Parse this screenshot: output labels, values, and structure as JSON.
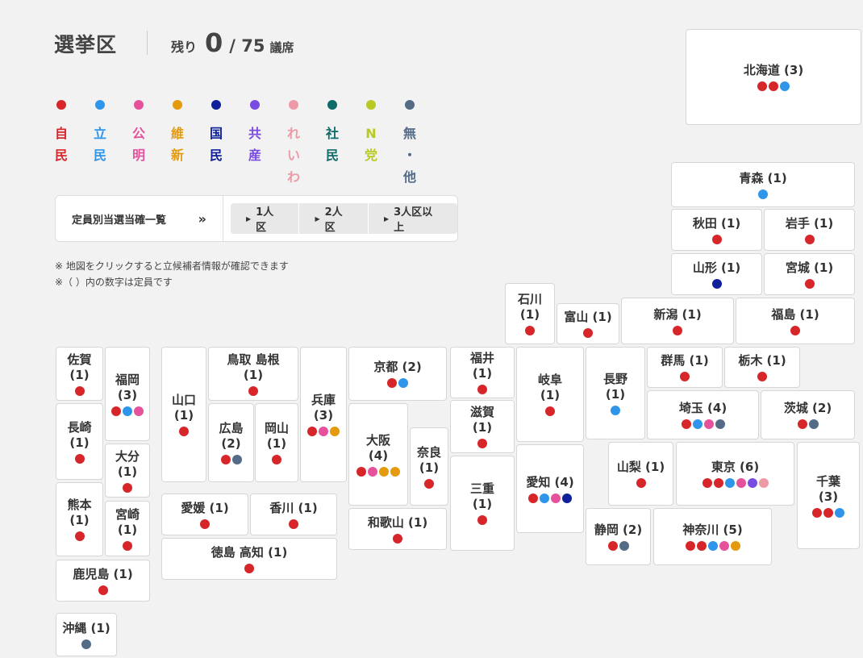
{
  "header": {
    "title": "選挙区",
    "remaining_label": "残り",
    "remaining_value": "0",
    "total": "/ 75",
    "unit": "議席"
  },
  "party_colors": {
    "ldp": "#d7262a",
    "cdp": "#2f95ea",
    "komei": "#e5529b",
    "ishin": "#e39a0f",
    "dpfp": "#10209a",
    "jcp": "#7a4be0",
    "reiwa": "#ee9aa6",
    "sdp": "#0f6a6a",
    "nhk": "#b8c923",
    "ind": "#546b86"
  },
  "legend": [
    {
      "key": "ldp",
      "chars": [
        "自",
        "民"
      ]
    },
    {
      "key": "cdp",
      "chars": [
        "立",
        "民"
      ]
    },
    {
      "key": "komei",
      "chars": [
        "公",
        "明"
      ]
    },
    {
      "key": "ishin",
      "chars": [
        "維",
        "新"
      ]
    },
    {
      "key": "dpfp",
      "chars": [
        "国",
        "民"
      ]
    },
    {
      "key": "jcp",
      "chars": [
        "共",
        "産"
      ]
    },
    {
      "key": "reiwa",
      "chars": [
        "れ",
        "い",
        "わ"
      ]
    },
    {
      "key": "sdp",
      "chars": [
        "社",
        "民"
      ]
    },
    {
      "key": "nhk",
      "chars": [
        "N",
        "党"
      ]
    },
    {
      "key": "ind",
      "chars": [
        "無",
        "・",
        "他"
      ]
    }
  ],
  "filter_panel": {
    "link_label": "定員別当選当確一覧",
    "link_icon": "double-chevron-right",
    "buttons": [
      "1人区",
      "2人区",
      "3人区以上"
    ]
  },
  "notes": [
    "※ 地図をクリックすると立候補者情報が確認できます",
    "※（ ）内の数字は定員です"
  ],
  "prefectures": [
    {
      "id": "hokkaido",
      "name": "北海道 (3)",
      "seats": [
        "ldp",
        "ldp",
        "cdp"
      ]
    },
    {
      "id": "aomori",
      "name": "青森 (1)",
      "seats": [
        "cdp"
      ]
    },
    {
      "id": "akita",
      "name": "秋田 (1)",
      "seats": [
        "ldp"
      ]
    },
    {
      "id": "iwate",
      "name": "岩手 (1)",
      "seats": [
        "ldp"
      ]
    },
    {
      "id": "yamagata",
      "name": "山形 (1)",
      "seats": [
        "dpfp"
      ]
    },
    {
      "id": "miyagi",
      "name": "宮城 (1)",
      "seats": [
        "ldp"
      ]
    },
    {
      "id": "ishikawa",
      "name": "石川\n(1)",
      "seats": [
        "ldp"
      ]
    },
    {
      "id": "toyama",
      "name": "富山 (1)",
      "seats": [
        "ldp"
      ]
    },
    {
      "id": "niigata",
      "name": "新潟 (1)",
      "seats": [
        "ldp"
      ]
    },
    {
      "id": "fukushima",
      "name": "福島 (1)",
      "seats": [
        "ldp"
      ]
    },
    {
      "id": "saga",
      "name": "佐賀\n(1)",
      "seats": [
        "ldp"
      ]
    },
    {
      "id": "fukuoka",
      "name": "福岡\n(3)",
      "seats": [
        "ldp",
        "cdp",
        "komei"
      ]
    },
    {
      "id": "nagasaki",
      "name": "長崎\n(1)",
      "seats": [
        "ldp"
      ]
    },
    {
      "id": "oita",
      "name": "大分\n(1)",
      "seats": [
        "ldp"
      ]
    },
    {
      "id": "kumamoto",
      "name": "熊本\n(1)",
      "seats": [
        "ldp"
      ]
    },
    {
      "id": "miyazaki",
      "name": "宮崎\n(1)",
      "seats": [
        "ldp"
      ]
    },
    {
      "id": "kagoshima",
      "name": "鹿児島 (1)",
      "seats": [
        "ldp"
      ]
    },
    {
      "id": "okinawa",
      "name": "沖縄 (1)",
      "seats": [
        "ind"
      ]
    },
    {
      "id": "yamaguchi",
      "name": "山口\n(1)",
      "seats": [
        "ldp"
      ]
    },
    {
      "id": "tottori_shimane",
      "name": "鳥取  島根\n(1)",
      "seats": [
        "ldp"
      ]
    },
    {
      "id": "hiroshima",
      "name": "広島\n(2)",
      "seats": [
        "ldp",
        "ind"
      ]
    },
    {
      "id": "okayama",
      "name": "岡山\n(1)",
      "seats": [
        "ldp"
      ]
    },
    {
      "id": "hyogo",
      "name": "兵庫\n(3)",
      "seats": [
        "ldp",
        "komei",
        "ishin"
      ]
    },
    {
      "id": "ehime",
      "name": "愛媛 (1)",
      "seats": [
        "ldp"
      ]
    },
    {
      "id": "kagawa",
      "name": "香川 (1)",
      "seats": [
        "ldp"
      ]
    },
    {
      "id": "tokushima_kochi",
      "name": "徳島  高知 (1)",
      "seats": [
        "ldp"
      ]
    },
    {
      "id": "kyoto",
      "name": "京都 (2)",
      "seats": [
        "ldp",
        "cdp"
      ]
    },
    {
      "id": "osaka",
      "name": "大阪\n(4)",
      "seats": [
        "ldp",
        "komei",
        "ishin",
        "ishin"
      ]
    },
    {
      "id": "nara",
      "name": "奈良\n(1)",
      "seats": [
        "ldp"
      ]
    },
    {
      "id": "wakayama",
      "name": "和歌山 (1)",
      "seats": [
        "ldp"
      ]
    },
    {
      "id": "fukui",
      "name": "福井\n(1)",
      "seats": [
        "ldp"
      ]
    },
    {
      "id": "shiga",
      "name": "滋賀\n(1)",
      "seats": [
        "ldp"
      ]
    },
    {
      "id": "mie",
      "name": "三重\n(1)",
      "seats": [
        "ldp"
      ]
    },
    {
      "id": "gifu",
      "name": "岐阜\n(1)",
      "seats": [
        "ldp"
      ]
    },
    {
      "id": "aichi",
      "name": "愛知 (4)",
      "seats": [
        "ldp",
        "cdp",
        "komei",
        "dpfp"
      ]
    },
    {
      "id": "nagano",
      "name": "長野\n(1)",
      "seats": [
        "cdp"
      ]
    },
    {
      "id": "gunma",
      "name": "群馬 (1)",
      "seats": [
        "ldp"
      ]
    },
    {
      "id": "tochigi",
      "name": "栃木 (1)",
      "seats": [
        "ldp"
      ]
    },
    {
      "id": "saitama",
      "name": "埼玉 (4)",
      "seats": [
        "ldp",
        "cdp",
        "komei",
        "ind"
      ]
    },
    {
      "id": "ibaraki",
      "name": "茨城 (2)",
      "seats": [
        "ldp",
        "ind"
      ]
    },
    {
      "id": "yamanashi",
      "name": "山梨 (1)",
      "seats": [
        "ldp"
      ]
    },
    {
      "id": "tokyo",
      "name": "東京 (6)",
      "seats": [
        "ldp",
        "ldp",
        "cdp",
        "komei",
        "jcp",
        "reiwa"
      ]
    },
    {
      "id": "chiba",
      "name": "千葉\n(3)",
      "seats": [
        "ldp",
        "ldp",
        "cdp"
      ]
    },
    {
      "id": "shizuoka",
      "name": "静岡 (2)",
      "seats": [
        "ldp",
        "ind"
      ]
    },
    {
      "id": "kanagawa",
      "name": "神奈川 (5)",
      "seats": [
        "ldp",
        "ldp",
        "cdp",
        "komei",
        "ishin"
      ]
    }
  ]
}
